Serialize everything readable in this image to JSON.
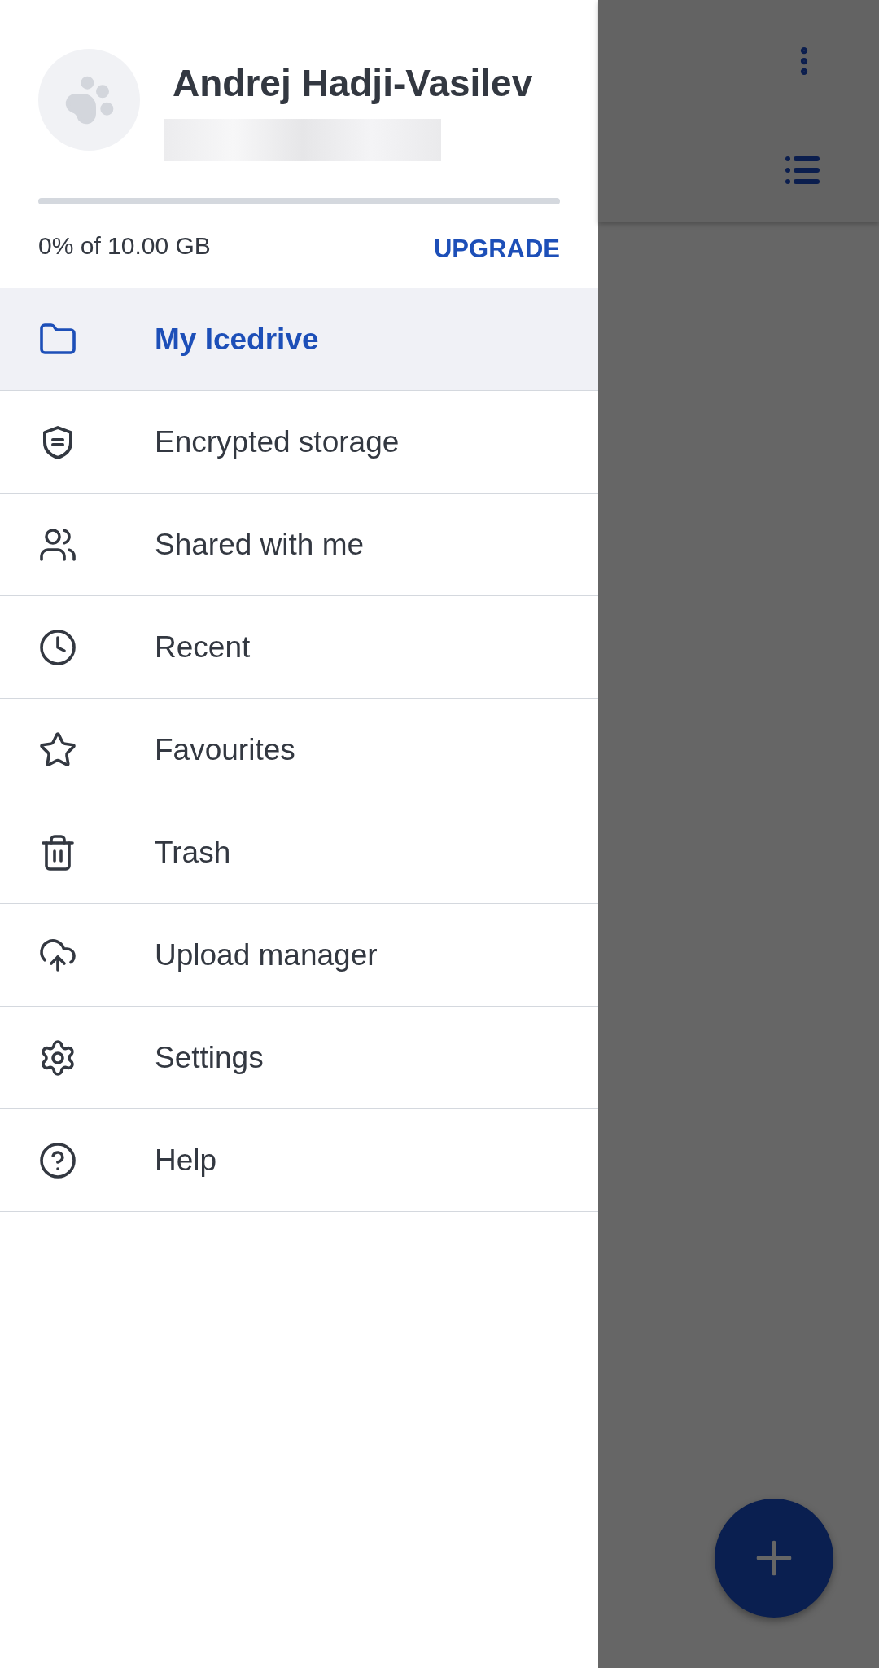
{
  "drawer": {
    "user_name": "Andrej Hadji-Vasilev",
    "storage": {
      "level": 0,
      "reading": "0% of 10.00 GB"
    },
    "upgrade_link": "UPGRADE",
    "items": [
      {
        "label": "My Icedrive",
        "selected": true
      },
      {
        "label": "Encrypted storage",
        "selected": false
      },
      {
        "label": "Shared with me",
        "selected": false
      },
      {
        "label": "Recent",
        "selected": false
      },
      {
        "label": "Favourites",
        "selected": false
      },
      {
        "label": "Trash",
        "selected": false
      },
      {
        "label": "Upload manager",
        "selected": false
      },
      {
        "label": "Settings",
        "selected": false
      },
      {
        "label": "Help",
        "selected": false
      }
    ]
  }
}
